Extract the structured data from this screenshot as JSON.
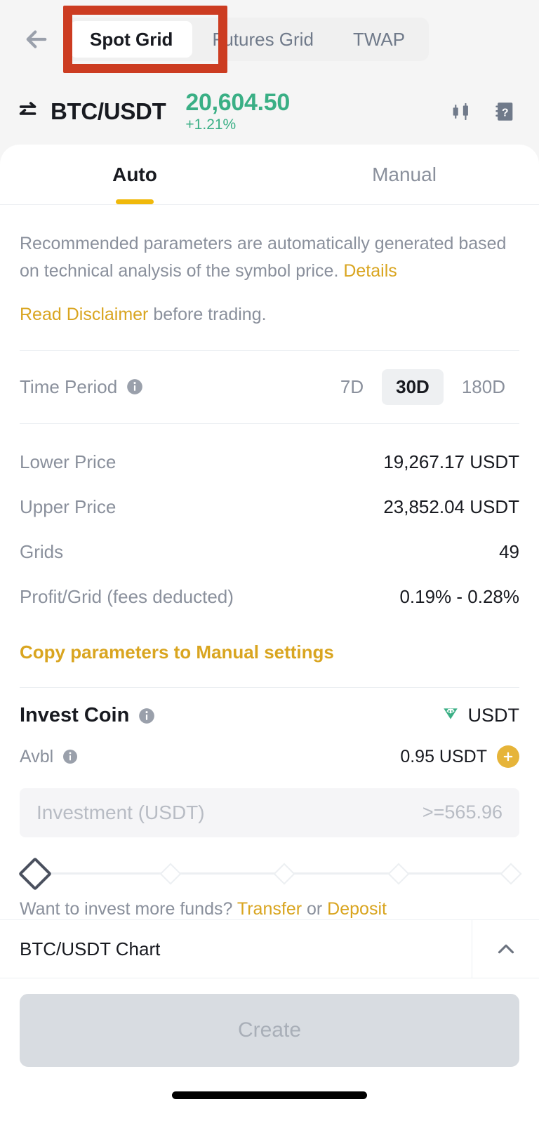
{
  "topbar": {
    "back_icon": "back-arrow-icon",
    "tabs": [
      {
        "label": "Spot Grid",
        "active": true
      },
      {
        "label": "Futures Grid",
        "active": false
      },
      {
        "label": "TWAP",
        "active": false
      }
    ],
    "highlight_color": "#cc3c21"
  },
  "symbol_header": {
    "swap_icon": "swap-arrows-icon",
    "pair": "BTC/USDT",
    "price": "20,604.50",
    "change": "+1.21%",
    "price_color": "#3aaf85",
    "candlestick_icon": "candlestick-chart-icon",
    "help_icon": "guide-question-icon"
  },
  "mode_tabs": [
    {
      "label": "Auto",
      "active": true
    },
    {
      "label": "Manual",
      "active": false
    }
  ],
  "accent_color": "#f0b90b",
  "info": {
    "paragraph_prefix": "Recommended parameters are automatically generated based on technical analysis of the symbol price. ",
    "details_link": "Details",
    "disclaimer_link": "Read Disclaimer",
    "disclaimer_suffix": " before trading."
  },
  "time_period": {
    "label": "Time Period",
    "info_icon": "info-icon",
    "options": [
      {
        "label": "7D",
        "active": false
      },
      {
        "label": "30D",
        "active": true
      },
      {
        "label": "180D",
        "active": false
      }
    ]
  },
  "parameters": [
    {
      "label": "Lower Price",
      "value": "19,267.17 USDT"
    },
    {
      "label": "Upper Price",
      "value": "23,852.04 USDT"
    },
    {
      "label": "Grids",
      "value": "49"
    },
    {
      "label": "Profit/Grid (fees deducted)",
      "value": "0.19% - 0.28%"
    }
  ],
  "copy_params_link": "Copy parameters to Manual settings",
  "invest": {
    "title": "Invest Coin",
    "info_icon": "info-icon",
    "coin_icon": "usdt-tether-icon",
    "coin_icon_color": "#3aaf85",
    "coin": "USDT",
    "avbl_label": "Avbl",
    "avbl_info_icon": "info-icon",
    "avbl_value": "0.95 USDT",
    "plus_icon": "plus-circle-icon",
    "plus_color": "#e6b439",
    "input_placeholder": "Investment (USDT)",
    "input_value": "",
    "min_hint": ">=565.96",
    "slider_percent": 0,
    "more_funds_prefix": "Want to invest more funds? ",
    "transfer_link": "Transfer",
    "more_funds_middle": " or ",
    "deposit_link": "Deposit"
  },
  "chart_strip": {
    "label": "BTC/USDT Chart",
    "toggle_icon": "chevron-up-icon"
  },
  "footer": {
    "create_label": "Create",
    "create_enabled": false
  }
}
